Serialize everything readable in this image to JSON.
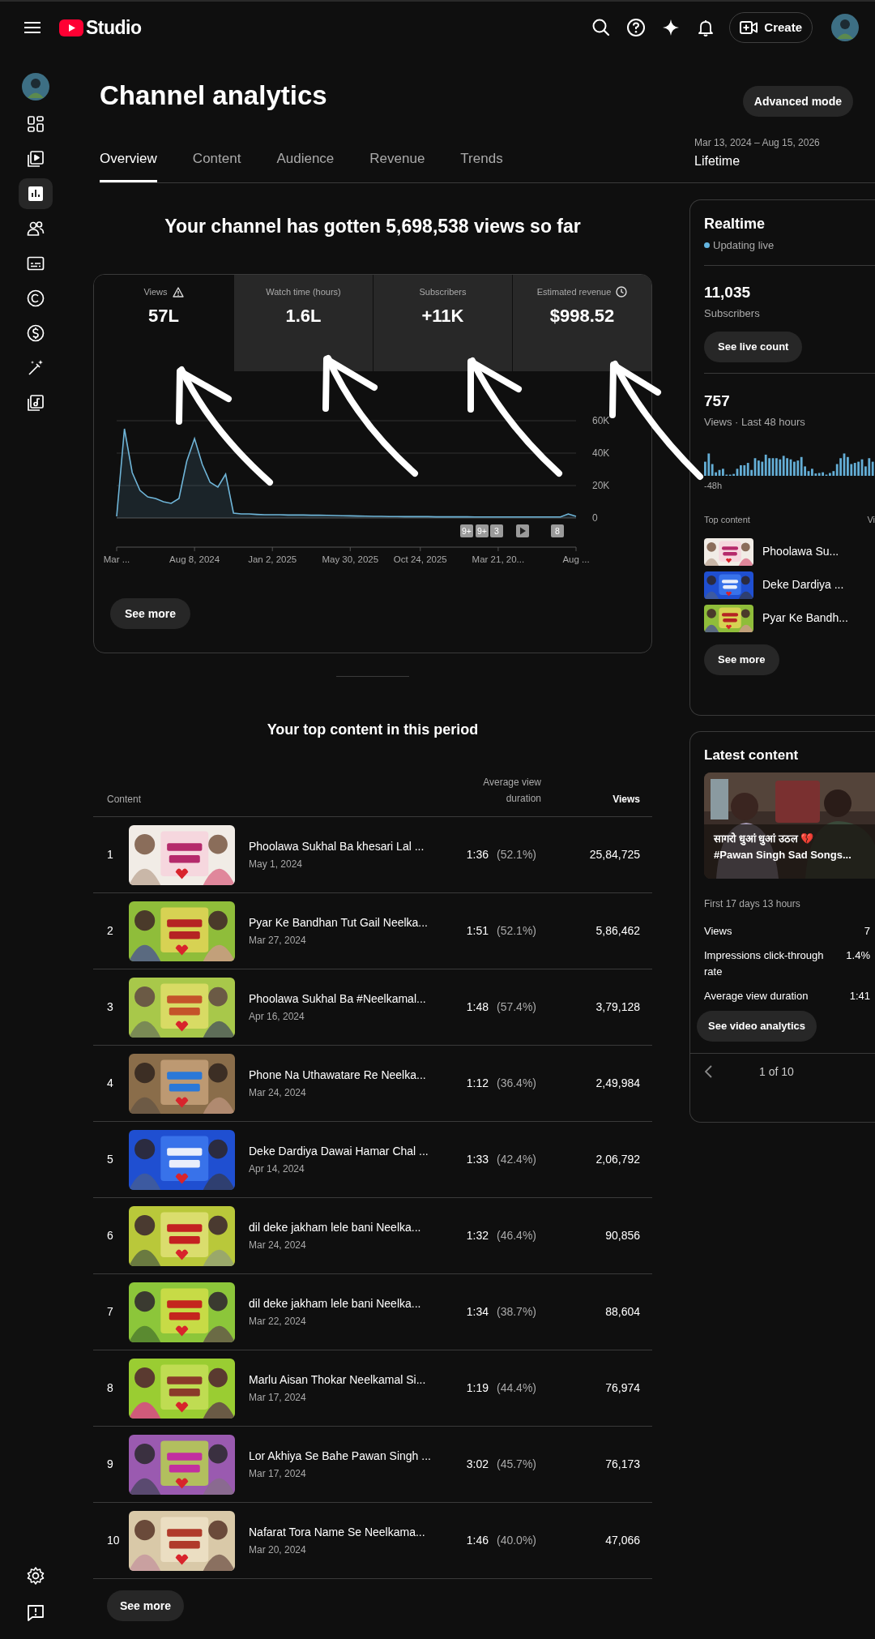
{
  "header": {
    "logo_text": "Studio",
    "create_button": "Create"
  },
  "sidebar": {
    "items": [
      {
        "selected": false
      },
      {
        "selected": false
      },
      {
        "selected": true
      },
      {
        "selected": false
      },
      {
        "selected": false
      },
      {
        "selected": false
      },
      {
        "selected": false
      },
      {
        "selected": false
      },
      {
        "selected": false
      }
    ]
  },
  "page": {
    "title": "Channel analytics",
    "advanced_button": "Advanced mode",
    "date_range": "Mar 13, 2024 – Aug 15, 2026",
    "period": "Lifetime"
  },
  "tabs": [
    {
      "label": "Overview",
      "selected": true
    },
    {
      "label": "Content",
      "selected": false
    },
    {
      "label": "Audience",
      "selected": false
    },
    {
      "label": "Revenue",
      "selected": false
    },
    {
      "label": "Trends",
      "selected": false
    }
  ],
  "headline": "Your channel has gotten 5,698,538 views so far",
  "metrics": [
    {
      "label": "Views",
      "value": "57L",
      "selected": true,
      "kind": "warning"
    },
    {
      "label": "Watch time (hours)",
      "value": "1.6L",
      "selected": false,
      "kind": "plain"
    },
    {
      "label": "Subscribers",
      "value": "+11K",
      "selected": false,
      "kind": "plain"
    },
    {
      "label": "Estimated revenue",
      "value": "$998.52",
      "selected": false,
      "kind": "clock"
    }
  ],
  "chart_data": {
    "type": "area",
    "categories": [
      "Mar ...",
      null,
      null,
      null,
      null,
      null,
      null,
      null,
      null,
      null,
      "Aug 8, 2024",
      null,
      null,
      null,
      null,
      null,
      null,
      null,
      null,
      null,
      "Jan 2, 2025",
      null,
      null,
      null,
      null,
      null,
      null,
      null,
      null,
      null,
      "May 30, 2025",
      null,
      null,
      null,
      null,
      null,
      null,
      null,
      null,
      "Oct 24, 2025",
      null,
      null,
      null,
      null,
      null,
      null,
      null,
      null,
      null,
      "Mar 21, 20...",
      null,
      null,
      null,
      null,
      null,
      null,
      null,
      null,
      null,
      "Aug ..."
    ],
    "series": [
      {
        "color": "#6fb5d8",
        "values": [
          1000,
          55000,
          28000,
          17000,
          13000,
          12000,
          10000,
          9000,
          12000,
          35000,
          49000,
          33000,
          22000,
          19000,
          27000,
          3000,
          2500,
          2500,
          2200,
          2000,
          2000,
          2000,
          1800,
          1800,
          1800,
          1700,
          1700,
          1600,
          1500,
          1400,
          1300,
          1200,
          1100,
          1000,
          1000,
          900,
          900,
          800,
          800,
          800,
          800,
          700,
          700,
          700,
          700,
          700,
          600,
          600,
          600,
          600,
          600,
          600,
          600,
          600,
          600,
          600,
          600,
          600,
          2500,
          1000
        ]
      }
    ],
    "ylim": [
      0,
      60000
    ],
    "yticks": [
      {
        "value": 0,
        "label": "0"
      },
      {
        "value": 20000,
        "label": "20K"
      },
      {
        "value": 40000,
        "label": "40K"
      },
      {
        "value": 60000,
        "label": "60K"
      }
    ]
  },
  "chart_markers": [
    {
      "kind": "count",
      "label": "9+"
    },
    {
      "kind": "count",
      "label": "9+"
    },
    {
      "kind": "count",
      "label": "3"
    },
    {
      "kind": "play"
    },
    {
      "kind": "count",
      "label": "8"
    }
  ],
  "chart_see_more": "See more",
  "top_content": {
    "title": "Your top content in this period",
    "columns": [
      {
        "label": "Content",
        "sorted": false
      },
      {
        "label": "Average view duration",
        "sorted": false
      },
      {
        "label": "Views",
        "sorted": true
      }
    ],
    "rows": [
      {
        "rank": "1",
        "title": "Phoolawa Sukhal Ba khesari Lal ...",
        "date": "May 1, 2024",
        "duration": "1:36",
        "percent": "(52.1%)",
        "views": "25,84,725"
      },
      {
        "rank": "2",
        "title": "Pyar Ke Bandhan Tut Gail Neelka...",
        "date": "Mar 27, 2024",
        "duration": "1:51",
        "percent": "(52.1%)",
        "views": "5,86,462"
      },
      {
        "rank": "3",
        "title": "Phoolawa Sukhal Ba #Neelkamal...",
        "date": "Apr 16, 2024",
        "duration": "1:48",
        "percent": "(57.4%)",
        "views": "3,79,128"
      },
      {
        "rank": "4",
        "title": "Phone Na Uthawatare Re Neelka...",
        "date": "Mar 24, 2024",
        "duration": "1:12",
        "percent": "(36.4%)",
        "views": "2,49,984"
      },
      {
        "rank": "5",
        "title": "Deke Dardiya Dawai Hamar Chal ...",
        "date": "Apr 14, 2024",
        "duration": "1:33",
        "percent": "(42.4%)",
        "views": "2,06,792"
      },
      {
        "rank": "6",
        "title": "dil deke jakham lele bani Neelka...",
        "date": "Mar 24, 2024",
        "duration": "1:32",
        "percent": "(46.4%)",
        "views": "90,856"
      },
      {
        "rank": "7",
        "title": "dil deke jakham lele bani Neelka...",
        "date": "Mar 22, 2024",
        "duration": "1:34",
        "percent": "(38.7%)",
        "views": "88,604"
      },
      {
        "rank": "8",
        "title": "Marlu Aisan Thokar Neelkamal Si...",
        "date": "Mar 17, 2024",
        "duration": "1:19",
        "percent": "(44.4%)",
        "views": "76,974"
      },
      {
        "rank": "9",
        "title": "Lor Akhiya Se Bahe Pawan Singh ...",
        "date": "Mar 17, 2024",
        "duration": "3:02",
        "percent": "(45.7%)",
        "views": "76,173"
      },
      {
        "rank": "10",
        "title": "Nafarat Tora Name Se Neelkama...",
        "date": "Mar 20, 2024",
        "duration": "1:46",
        "percent": "(40.0%)",
        "views": "47,066"
      }
    ],
    "see_more": "See more"
  },
  "realtime": {
    "title": "Realtime",
    "status": "Updating live",
    "subscribers": "11,035",
    "subscribers_label": "Subscribers",
    "live_count_button": "See live count",
    "views": "757",
    "views_label": "Views · Last 48 hours",
    "axis_start": "-48h",
    "top_content_label": "Top content",
    "column_label": "Vi",
    "items": [
      {
        "title": "Phoolawa Su..."
      },
      {
        "title": "Deke Dardiya ..."
      },
      {
        "title": "Pyar Ke Bandh..."
      }
    ],
    "see_more": "See more"
  },
  "latest": {
    "title": "Latest content",
    "video_title_lines": [
      "सागरो धुआं धुआं उठल 💔",
      "#Pawan Singh Sad Songs..."
    ],
    "period": "First 17 days 13 hours",
    "stats": [
      {
        "label": "Views",
        "value": "7"
      },
      {
        "label": "Impressions click-through rate",
        "value": "1.4%"
      },
      {
        "label": "Average view duration",
        "value": "1:41"
      }
    ],
    "analytics_button": "See video analytics",
    "pager": "1 of 10"
  }
}
